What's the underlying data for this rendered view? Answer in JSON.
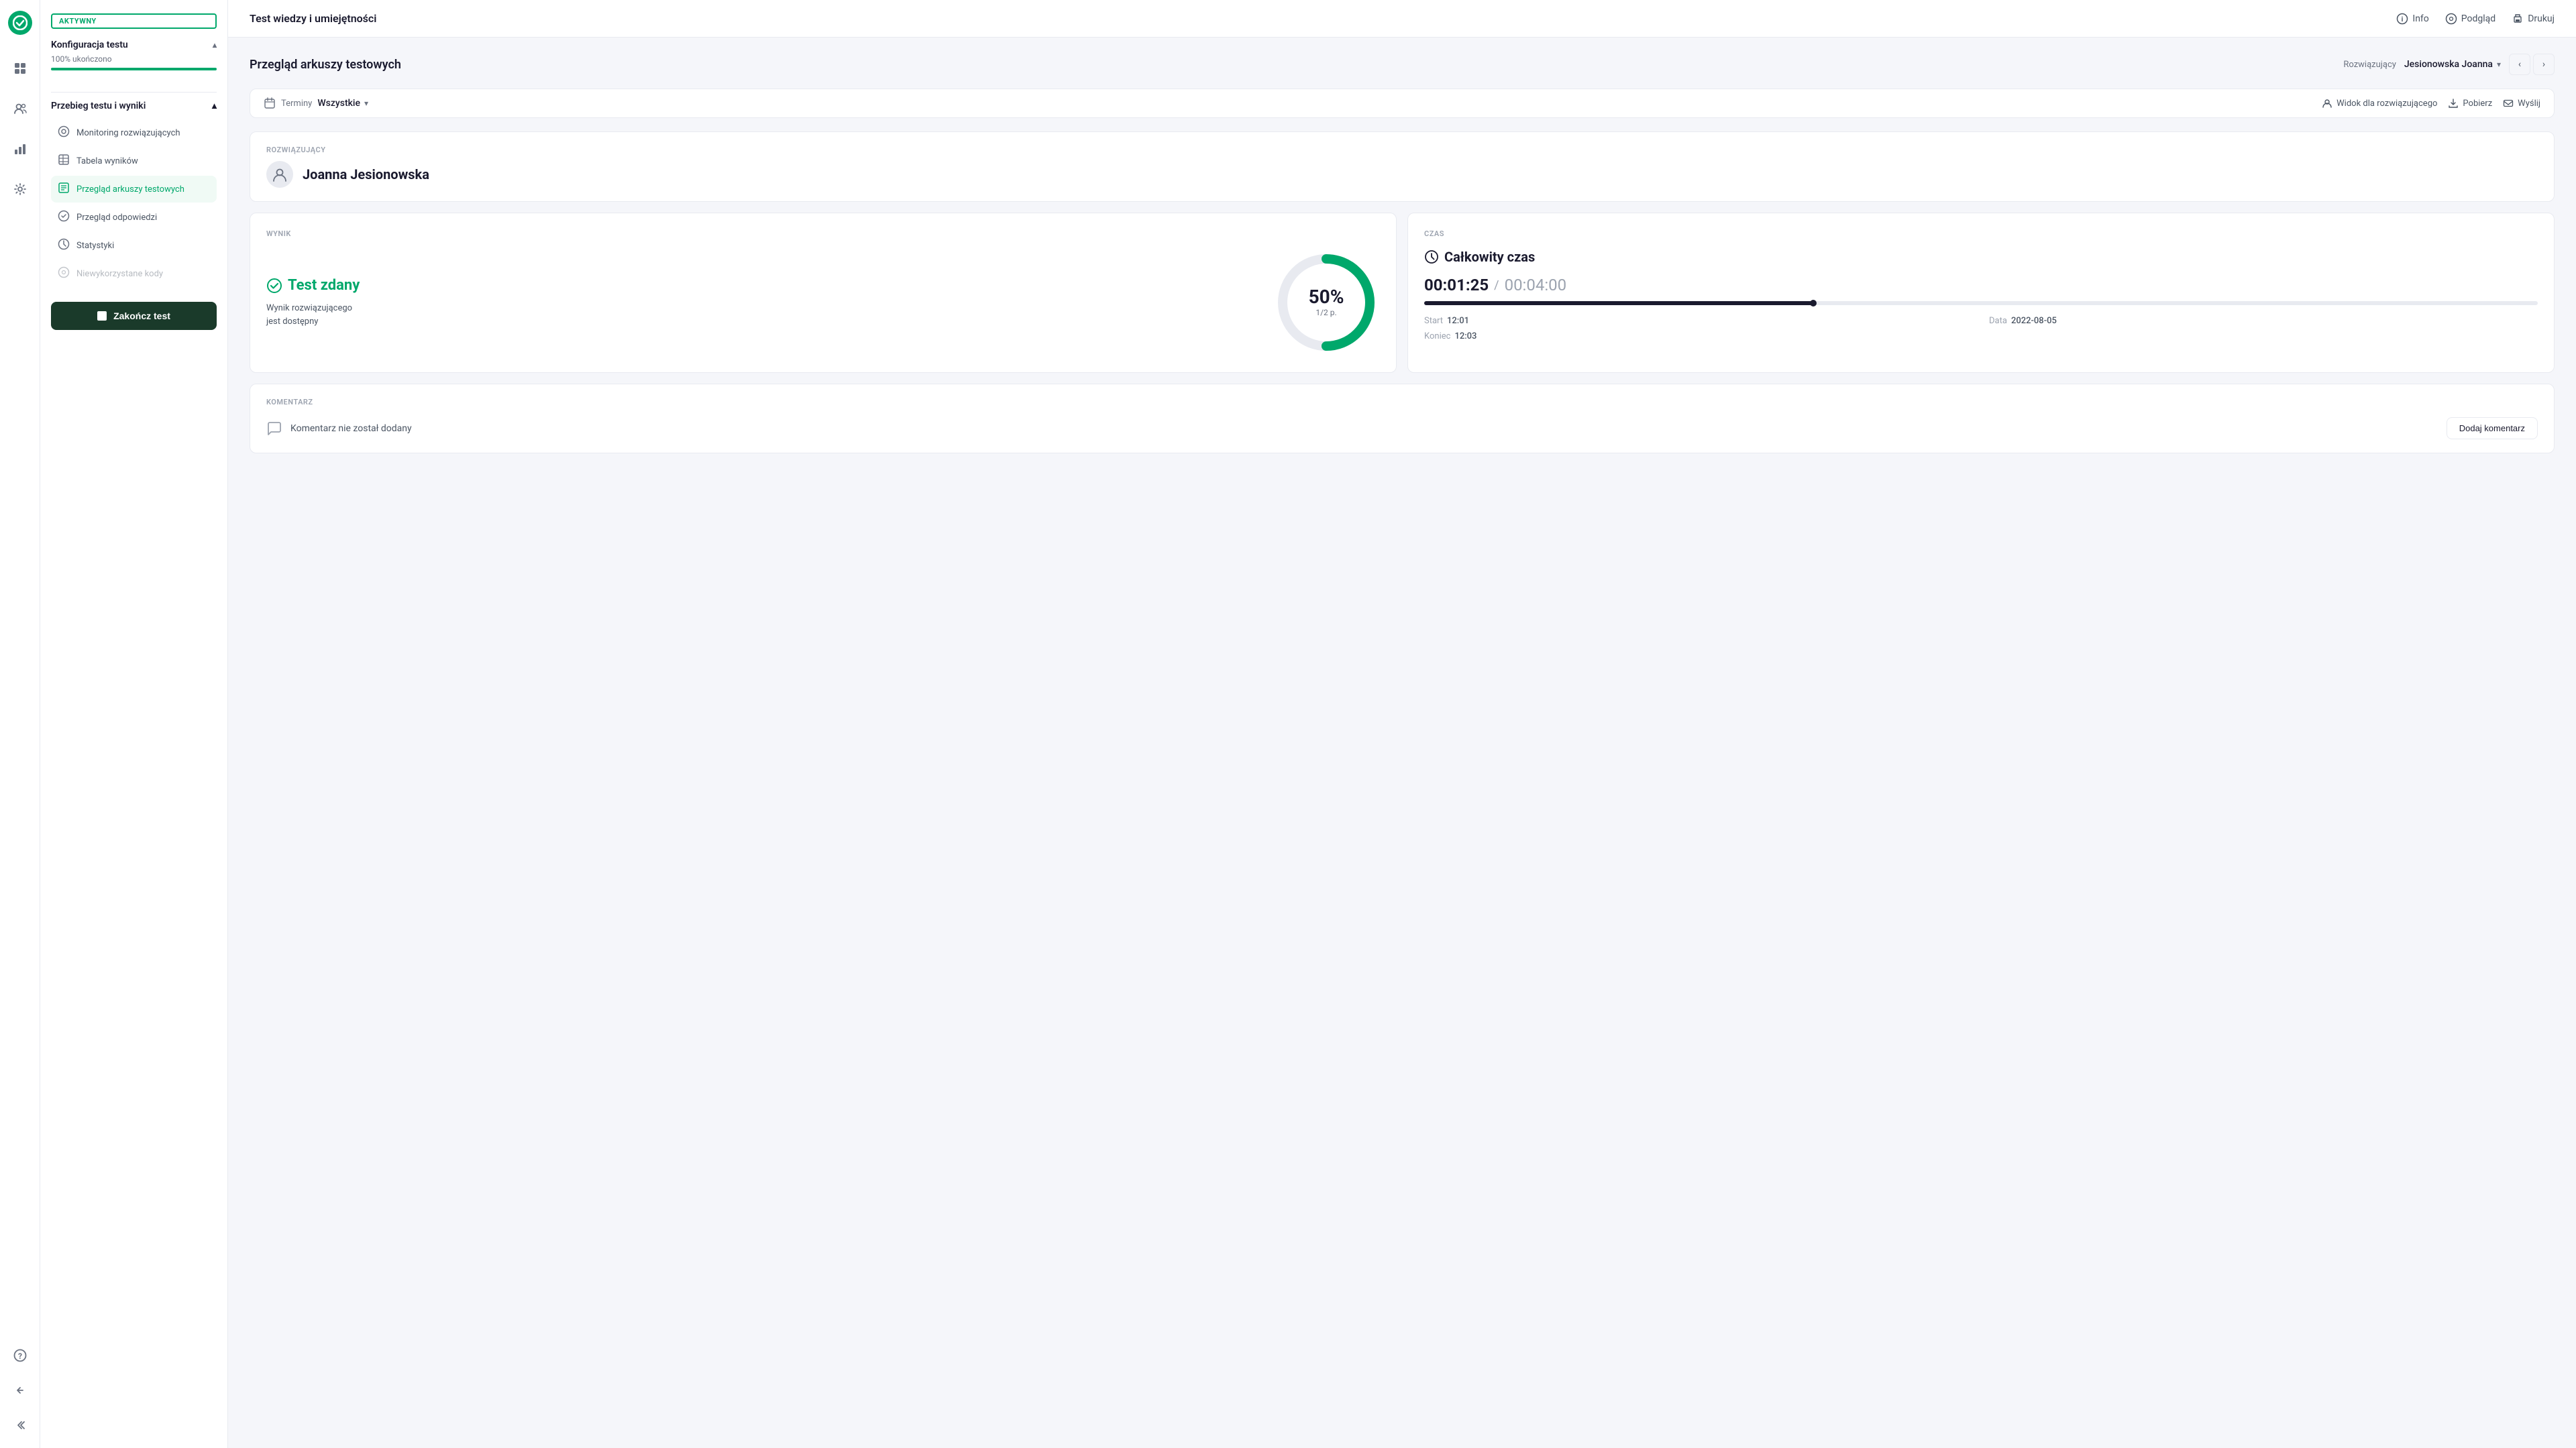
{
  "app": {
    "title": "Test wiedzy i umiejętności"
  },
  "topbar": {
    "title": "Test wiedzy i umiejętności",
    "actions": {
      "info": "Info",
      "preview": "Podgląd",
      "print": "Drukuj"
    }
  },
  "sidebar": {
    "badge": "AKTYWNY",
    "config_section": "Konfiguracja testu",
    "progress_text": "100% ukończono",
    "progress_percent": 100,
    "run_section": "Przebieg testu i wyniki",
    "nav_items": [
      {
        "label": "Monitoring rozwiązujących",
        "icon": "⊙",
        "active": false,
        "disabled": false
      },
      {
        "label": "Tabela wyników",
        "icon": "▦",
        "active": false,
        "disabled": false
      },
      {
        "label": "Przegląd arkuszy testowych",
        "icon": "☰",
        "active": true,
        "disabled": false
      },
      {
        "label": "Przegląd odpowiedzi",
        "icon": "✓",
        "active": false,
        "disabled": false
      },
      {
        "label": "Statystyki",
        "icon": "◎",
        "active": false,
        "disabled": false
      },
      {
        "label": "Niewykorzystane kody",
        "icon": "⊘",
        "active": false,
        "disabled": true
      }
    ],
    "end_test_button": "Zakończ test"
  },
  "sheet": {
    "title": "Przegląd arkuszy testowych",
    "resolver_label": "Rozwiązujący",
    "resolver_name": "Jesionowska Joanna",
    "filter": {
      "label": "Terminy",
      "value": "Wszystkie",
      "view_label": "Widok dla rozwiązującego",
      "download_label": "Pobierz",
      "send_label": "Wyślij"
    },
    "resolver_section_label": "ROZWIĄZUJĄCY",
    "resolver_full_name": "Joanna Jesionowska",
    "result": {
      "section_label": "WYNIK",
      "status": "Test zdany",
      "description_line1": "Wynik rozwiązującego",
      "description_line2": "jest dostępny",
      "percent": "50%",
      "fraction": "1/2 p."
    },
    "time": {
      "section_label": "CZAS",
      "title": "Całkowity czas",
      "used": "00:01:25",
      "separator": "/",
      "total": "00:04:00",
      "bar_percent": 35,
      "start_label": "Start",
      "start_value": "12:01",
      "date_label": "Data",
      "date_value": "2022-08-05",
      "end_label": "Koniec",
      "end_value": "12:03"
    },
    "comment": {
      "section_label": "KOMENTARZ",
      "text": "Komentarz nie został dodany",
      "add_button": "Dodaj komentarz"
    }
  },
  "icons": {
    "logo": "✓",
    "grid": "⊞",
    "users": "👤",
    "analytics": "📊",
    "settings": "⚙",
    "help": "?",
    "back": "↩",
    "collapse": "«",
    "info": "ℹ",
    "eye": "◉",
    "printer": "🖨",
    "calendar": "📅",
    "person": "👤",
    "download": "⬇",
    "envelope": "✉",
    "chevron_down": "▾",
    "chevron_left": "‹",
    "chevron_right": "›",
    "chevron_up": "▴",
    "check_circle": "✓",
    "clock": "🕐",
    "comment": "💬"
  }
}
